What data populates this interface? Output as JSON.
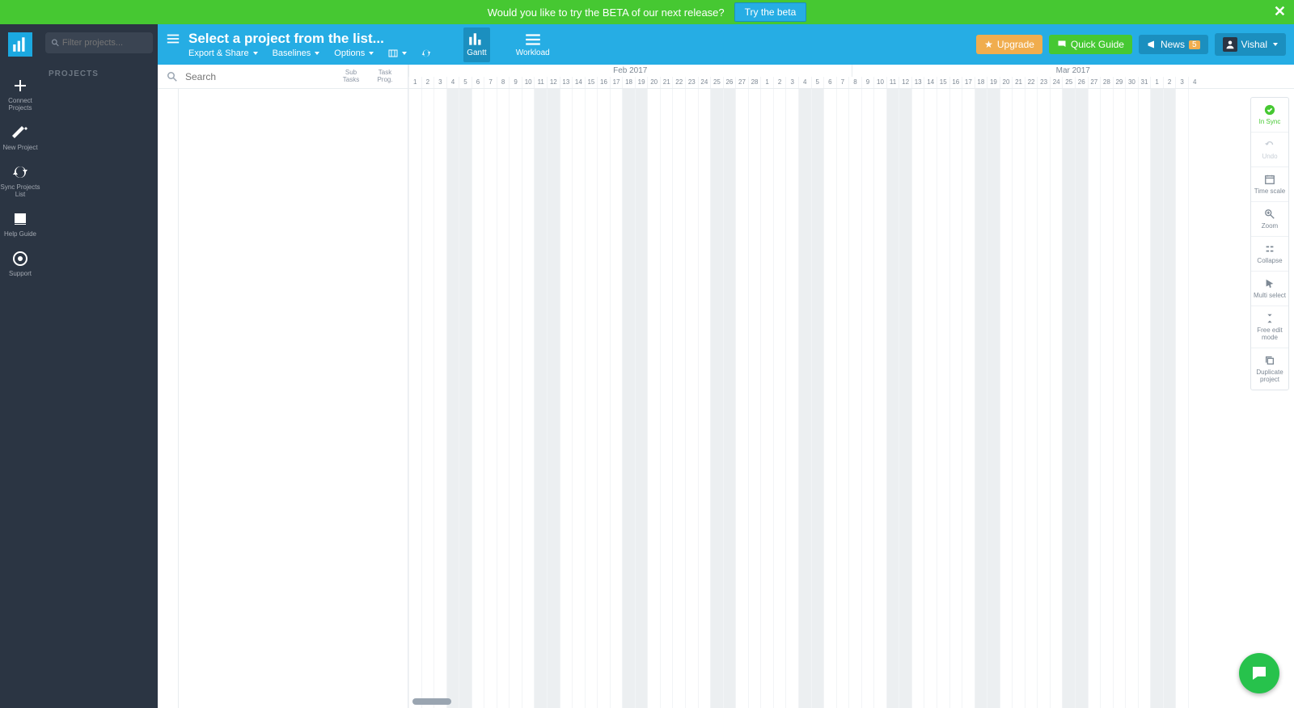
{
  "banner": {
    "text": "Would you like to try the BETA of our next release?",
    "button": "Try the beta"
  },
  "sidebar": {
    "filter_placeholder": "Filter projects...",
    "projects_label": "PROJECTS",
    "items": [
      {
        "label": "Connect Projects"
      },
      {
        "label": "New Project"
      },
      {
        "label": "Sync Projects List"
      },
      {
        "label": "Help Guide"
      },
      {
        "label": "Support"
      }
    ]
  },
  "topbar": {
    "title": "Select a project from the list...",
    "menus": [
      "Export & Share",
      "Baselines",
      "Options"
    ],
    "tabs": {
      "gantt": "Gantt",
      "workload": "Workload"
    },
    "upgrade": "Upgrade",
    "guide": "Quick Guide",
    "news": "News",
    "news_count": "5",
    "user": "Vishal"
  },
  "task_panel": {
    "search_placeholder": "Search",
    "col1": "Sub Tasks",
    "col2": "Task Prog."
  },
  "calendar": {
    "months": [
      "Feb 2017",
      "Mar 2017"
    ],
    "days": [
      1,
      2,
      3,
      4,
      5,
      6,
      7,
      8,
      9,
      10,
      11,
      12,
      13,
      14,
      15,
      16,
      17,
      18,
      19,
      20,
      21,
      22,
      23,
      24,
      25,
      26,
      27,
      28,
      1,
      2,
      3,
      4,
      5,
      6,
      7,
      8,
      9,
      10,
      11,
      12,
      13,
      14,
      15,
      16,
      17,
      18,
      19,
      20,
      21,
      22,
      23,
      24,
      25,
      26,
      27,
      28,
      29,
      30,
      31,
      1,
      2,
      3,
      4
    ],
    "weekend_idx": [
      3,
      4,
      10,
      11,
      17,
      18,
      24,
      25,
      31,
      32,
      38,
      39,
      45,
      46,
      52,
      53,
      59,
      60
    ]
  },
  "right_tools": [
    {
      "label": "In Sync",
      "cls": "sync"
    },
    {
      "label": "Undo",
      "cls": "disabled"
    },
    {
      "label": "Time scale",
      "cls": ""
    },
    {
      "label": "Zoom",
      "cls": ""
    },
    {
      "label": "Collapse",
      "cls": ""
    },
    {
      "label": "Multi select",
      "cls": ""
    },
    {
      "label": "Free edit mode",
      "cls": ""
    },
    {
      "label": "Duplicate project",
      "cls": ""
    }
  ]
}
